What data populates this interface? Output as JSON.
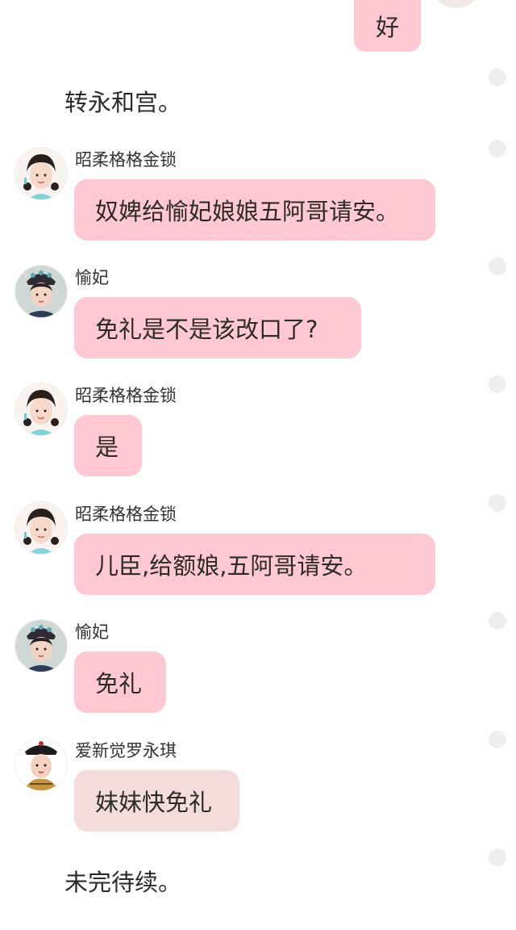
{
  "self_message": {
    "text": "好"
  },
  "narrations": [
    "转永和宫。",
    "未完待续。"
  ],
  "messages": [
    {
      "sender": "昭柔格格金锁",
      "text": "奴婢给愉妃娘娘五阿哥请安。",
      "avatar": "girl-avatar"
    },
    {
      "sender": "愉妃",
      "text": "免礼是不是该改口了?",
      "avatar": "consort-avatar"
    },
    {
      "sender": "昭柔格格金锁",
      "text": "是",
      "avatar": "girl-avatar"
    },
    {
      "sender": "昭柔格格金锁",
      "text": "儿臣,给额娘,五阿哥请安。",
      "avatar": "girl-avatar"
    },
    {
      "sender": "愉妃",
      "text": "免礼",
      "avatar": "consort-avatar"
    },
    {
      "sender": "爱新觉罗永琪",
      "text": "妹妹快免礼",
      "avatar": "prince-avatar"
    }
  ],
  "colors": {
    "bubble_pink": "#ffc8d3",
    "bubble_light": "#f4dcdc",
    "status_dot": "#eeeeee"
  }
}
